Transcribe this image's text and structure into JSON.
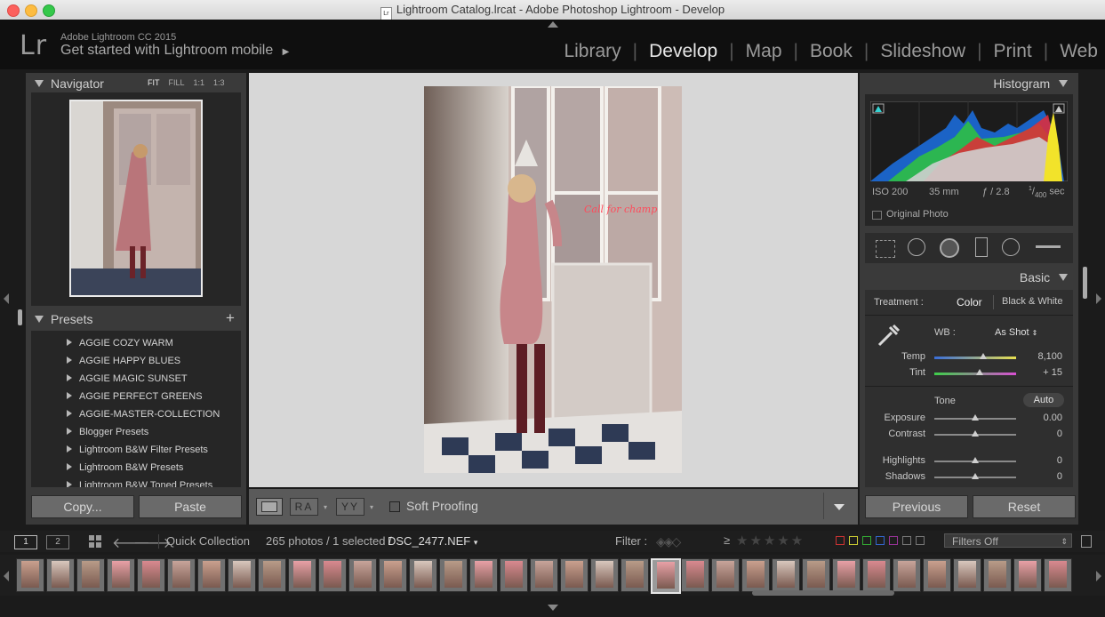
{
  "window": {
    "title": "Lightroom Catalog.lrcat - Adobe Photoshop Lightroom - Develop",
    "doc_icon": "Lr"
  },
  "identity": {
    "logo": "Lr",
    "app_name": "Adobe Lightroom CC 2015",
    "mobile_link": "Get started with Lightroom mobile"
  },
  "modules": [
    "Library",
    "Develop",
    "Map",
    "Book",
    "Slideshow",
    "Print",
    "Web"
  ],
  "active_module": "Develop",
  "navigator": {
    "title": "Navigator",
    "zoom_options": [
      "FIT",
      "FILL",
      "1:1",
      "1:3"
    ]
  },
  "presets": {
    "title": "Presets",
    "add_symbol": "+",
    "items": [
      "AGGIE COZY WARM",
      "AGGIE HAPPY BLUES",
      "AGGIE MAGIC SUNSET",
      "AGGIE PERFECT GREENS",
      "AGGIE-MASTER-COLLECTION",
      "Blogger Presets",
      "Lightroom B&W Filter Presets",
      "Lightroom B&W Presets",
      "Lightroom B&W Toned Presets"
    ]
  },
  "left_buttons": {
    "copy": "Copy...",
    "paste": "Paste"
  },
  "toolbar": {
    "soft_proofing": "Soft Proofing",
    "ra_label": "RA",
    "yy_label": "YY"
  },
  "histogram": {
    "title": "Histogram",
    "iso": "ISO 200",
    "focal": "35 mm",
    "aperture": "ƒ / 2.8",
    "shutter_num": "1",
    "shutter_den": "400",
    "shutter_unit": "sec",
    "original_photo": "Original Photo"
  },
  "basic": {
    "title": "Basic",
    "treatment_label": "Treatment :",
    "treatment_color": "Color",
    "treatment_bw": "Black & White",
    "wb_label": "WB :",
    "wb_value": "As Shot",
    "temp_label": "Temp",
    "temp_value": "8,100",
    "temp_pos": 0.6,
    "tint_label": "Tint",
    "tint_value": "+ 15",
    "tint_pos": 0.55,
    "tone_label": "Tone",
    "auto_label": "Auto",
    "exposure_label": "Exposure",
    "exposure_value": "0.00",
    "contrast_label": "Contrast",
    "contrast_value": "0",
    "highlights_label": "Highlights",
    "highlights_value": "0",
    "shadows_label": "Shadows",
    "shadows_value": "0"
  },
  "right_buttons": {
    "previous": "Previous",
    "reset": "Reset"
  },
  "filmstrip_bar": {
    "view1": "1",
    "view2": "2",
    "source": "Quick Collection",
    "count": "265 photos / 1 selected /",
    "filename": "DSC_2477.NEF",
    "filter_label": "Filter :",
    "rating_op": "≥",
    "filters_off": "Filters Off"
  },
  "colors": {
    "accent": "#e6e6e6",
    "panel": "#3a3a3a",
    "background": "#1b1b1b"
  }
}
